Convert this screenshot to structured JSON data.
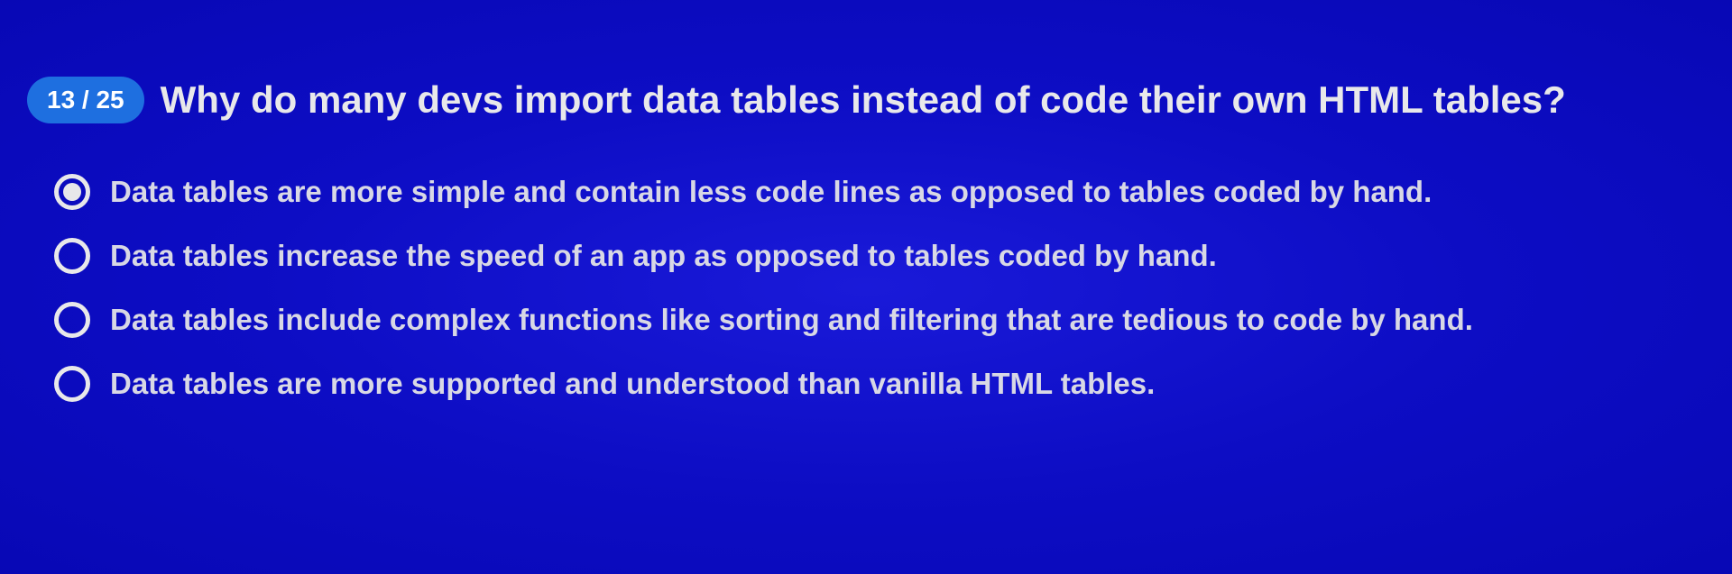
{
  "quiz": {
    "counter": "13 / 25",
    "question": "Why do many devs import data tables instead of code their own HTML tables?",
    "options": [
      {
        "text": "Data tables are more simple and contain less code lines as opposed to tables coded by hand.",
        "selected": true
      },
      {
        "text": "Data tables increase the speed of an app as opposed to tables coded by hand.",
        "selected": false
      },
      {
        "text": "Data tables include complex functions like sorting and filtering that are tedious to code by hand.",
        "selected": false
      },
      {
        "text": "Data tables are more supported and understood than vanilla HTML tables.",
        "selected": false
      }
    ]
  }
}
